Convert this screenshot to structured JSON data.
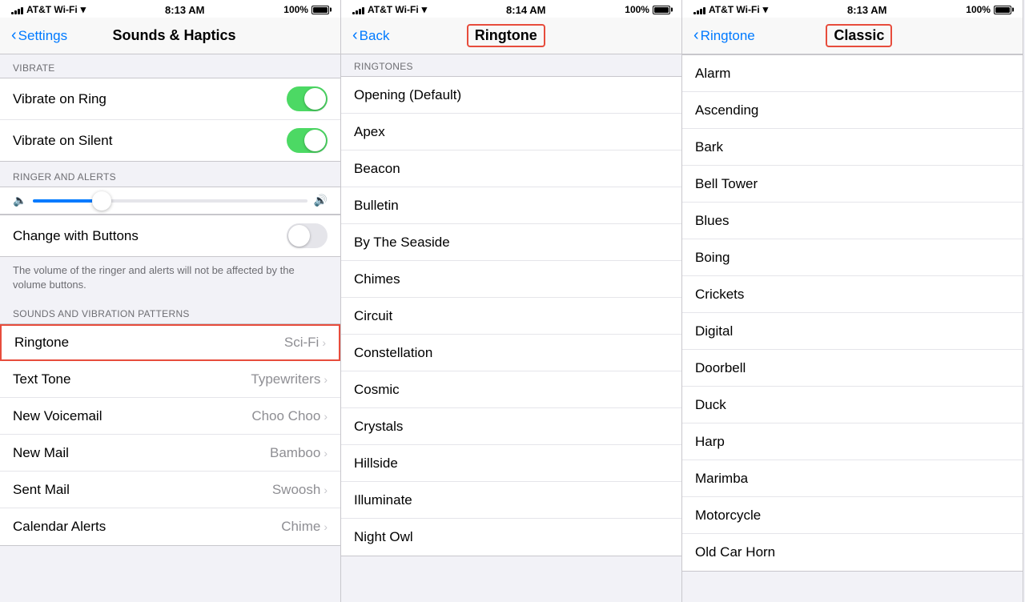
{
  "panel1": {
    "statusBar": {
      "carrier": "AT&T Wi-Fi",
      "time": "8:13 AM",
      "battery": "100%"
    },
    "navTitle": "Sounds & Haptics",
    "backLabel": "Settings",
    "sections": [
      {
        "id": "vibrate",
        "header": "VIBRATE",
        "rows": [
          {
            "id": "vibrate-ring",
            "label": "Vibrate on Ring",
            "type": "toggle",
            "value": true
          },
          {
            "id": "vibrate-silent",
            "label": "Vibrate on Silent",
            "type": "toggle",
            "value": true
          }
        ]
      }
    ],
    "ringerSection": {
      "header": "RINGER AND ALERTS"
    },
    "changeWithButtons": {
      "label": "Change with Buttons",
      "value": false,
      "note": "The volume of the ringer and alerts will not be affected by the volume buttons."
    },
    "soundsSection": {
      "header": "SOUNDS AND VIBRATION PATTERNS",
      "rows": [
        {
          "id": "ringtone",
          "label": "Ringtone",
          "value": "Sci-Fi",
          "highlighted": true
        },
        {
          "id": "text-tone",
          "label": "Text Tone",
          "value": "Typewriters"
        },
        {
          "id": "new-voicemail",
          "label": "New Voicemail",
          "value": "Choo Choo"
        },
        {
          "id": "new-mail",
          "label": "New Mail",
          "value": "Bamboo"
        },
        {
          "id": "sent-mail",
          "label": "Sent Mail",
          "value": "Swoosh"
        },
        {
          "id": "calendar-alerts",
          "label": "Calendar Alerts",
          "value": "Chime"
        }
      ]
    }
  },
  "panel2": {
    "statusBar": {
      "carrier": "AT&T Wi-Fi",
      "time": "8:14 AM",
      "battery": "100%"
    },
    "backLabel": "Back",
    "navTitle": "Ringtone",
    "sectionHeader": "RINGTONES",
    "items": [
      "Opening (Default)",
      "Apex",
      "Beacon",
      "Bulletin",
      "By The Seaside",
      "Chimes",
      "Circuit",
      "Constellation",
      "Cosmic",
      "Crystals",
      "Hillside",
      "Illuminate",
      "Night Owl"
    ]
  },
  "panel3": {
    "statusBar": {
      "carrier": "AT&T Wi-Fi",
      "time": "8:13 AM",
      "battery": "100%"
    },
    "backLabel": "Ringtone",
    "navTitle": "Classic",
    "items": [
      "Alarm",
      "Ascending",
      "Bark",
      "Bell Tower",
      "Blues",
      "Boing",
      "Crickets",
      "Digital",
      "Doorbell",
      "Duck",
      "Harp",
      "Marimba",
      "Motorcycle",
      "Old Car Horn"
    ]
  }
}
